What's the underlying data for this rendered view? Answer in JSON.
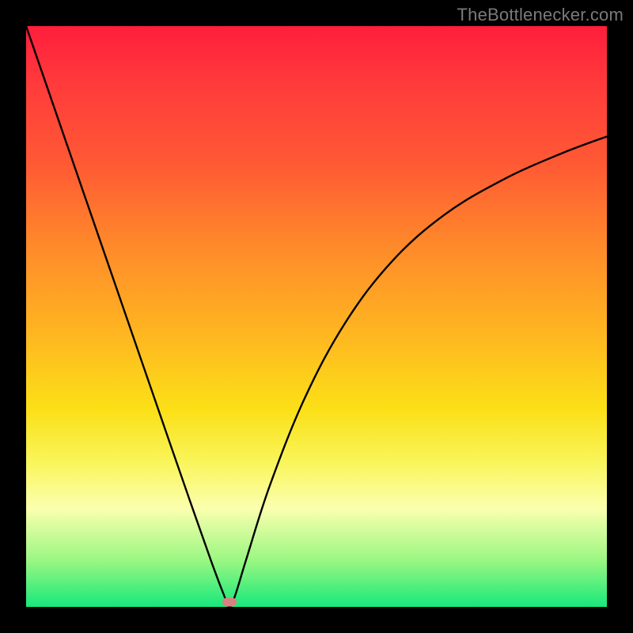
{
  "watermark": {
    "text": "TheBottlenecker.com"
  },
  "chart_data": {
    "type": "line",
    "title": "",
    "xlabel": "",
    "ylabel": "",
    "xlim": [
      0,
      100
    ],
    "ylim": [
      0,
      100
    ],
    "grid": false,
    "series": [
      {
        "name": "bottleneck-curve",
        "x": [
          0,
          5,
          10,
          15,
          20,
          25,
          29,
          32,
          34,
          35,
          36,
          38,
          42,
          48,
          55,
          63,
          72,
          82,
          92,
          100
        ],
        "values": [
          100,
          85.5,
          71,
          56.5,
          42,
          27.5,
          16,
          7.5,
          2.2,
          0,
          2.0,
          8.5,
          21,
          36,
          49,
          59.5,
          67.5,
          73.5,
          78,
          81
        ]
      }
    ],
    "marker": {
      "x": 35,
      "y": 0.8,
      "color": "#d98080"
    }
  }
}
